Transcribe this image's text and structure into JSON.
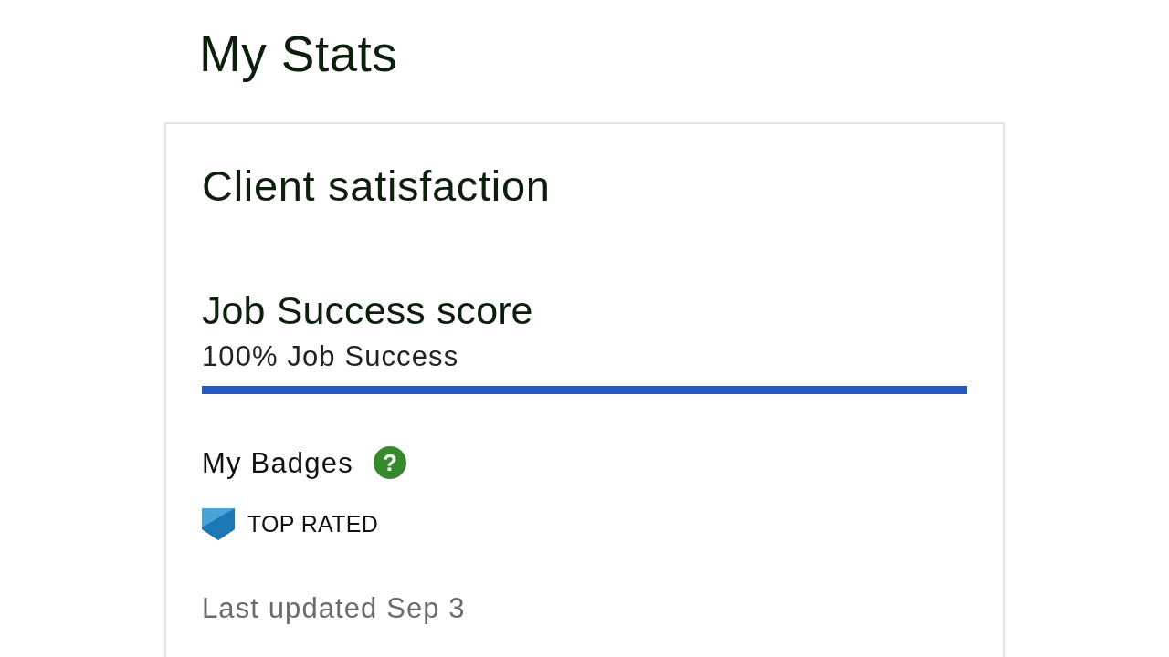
{
  "page_title": "My Stats",
  "card": {
    "title": "Client satisfaction",
    "job_success": {
      "title": "Job Success score",
      "value": "100% Job Success",
      "level": 1
    },
    "badges": {
      "title": "My Badges",
      "help": "?",
      "items": [
        {
          "label": "TOP RATED"
        }
      ]
    },
    "last_updated": "Last updated Sep 3"
  }
}
